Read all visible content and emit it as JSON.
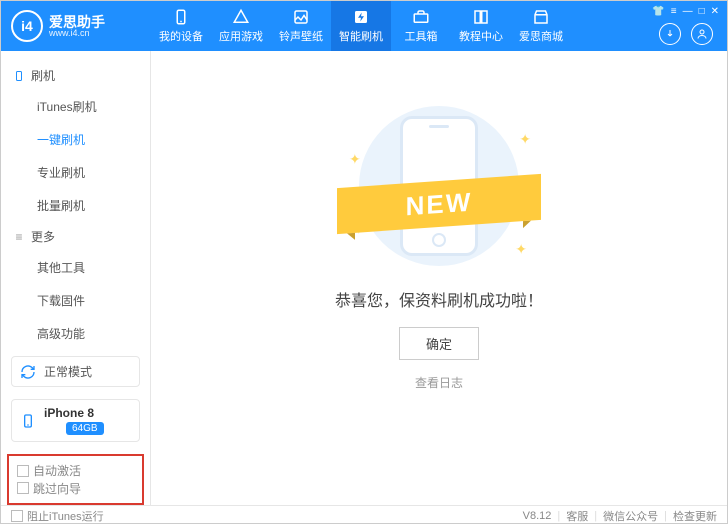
{
  "app": {
    "title": "爱思助手",
    "subtitle": "www.i4.cn"
  },
  "nav": {
    "items": [
      {
        "label": "我的设备"
      },
      {
        "label": "应用游戏"
      },
      {
        "label": "铃声壁纸"
      },
      {
        "label": "智能刷机"
      },
      {
        "label": "工具箱"
      },
      {
        "label": "教程中心"
      },
      {
        "label": "爱思商城"
      }
    ],
    "active_index": 3
  },
  "window_controls": {
    "dropdown": "▾",
    "menu": "≡",
    "min": "—",
    "max": "□",
    "close": "✕"
  },
  "sidebar": {
    "group1_label": "刷机",
    "group1_items": [
      "iTunes刷机",
      "一键刷机",
      "专业刷机",
      "批量刷机"
    ],
    "group1_active": 1,
    "group2_label": "更多",
    "group2_items": [
      "其他工具",
      "下载固件",
      "高级功能"
    ]
  },
  "mode": {
    "label": "正常模式"
  },
  "device": {
    "name": "iPhone 8",
    "storage": "64GB"
  },
  "options": {
    "auto_activate": "自动激活",
    "skip_guide": "跳过向导"
  },
  "main": {
    "ribbon": "NEW",
    "message": "恭喜您，保资料刷机成功啦！",
    "ok": "确定",
    "log": "查看日志"
  },
  "footer": {
    "block_itunes": "阻止iTunes运行",
    "version": "V8.12",
    "support": "客服",
    "wechat": "微信公众号",
    "update": "检查更新"
  }
}
